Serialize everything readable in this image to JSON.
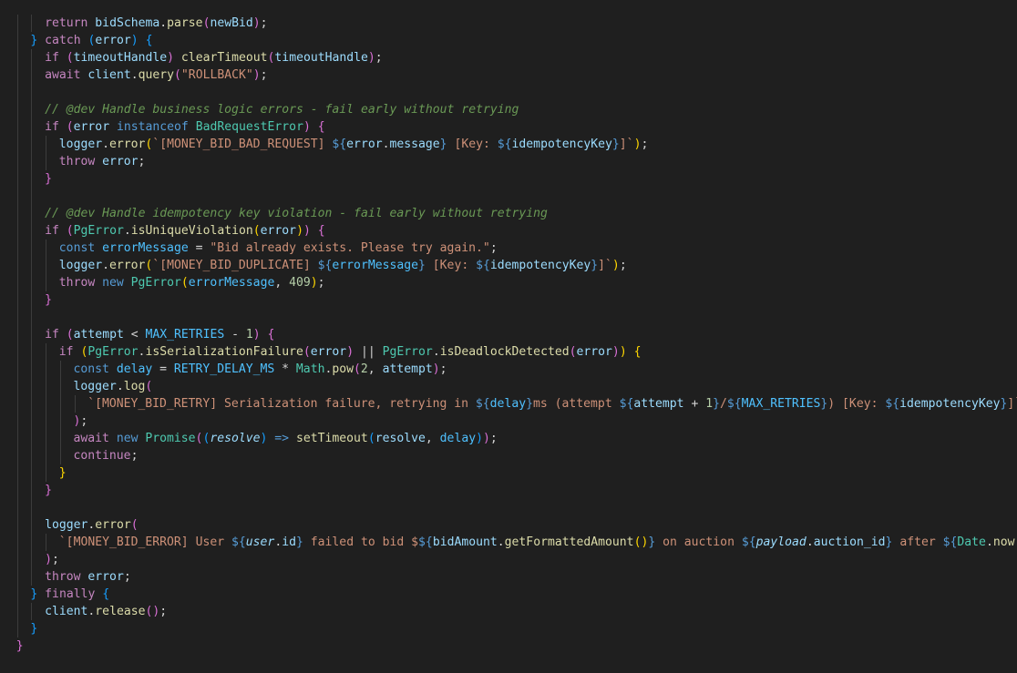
{
  "editor": {
    "theme_colors": {
      "background": "#1f1f1f",
      "keyword": "#c586c0",
      "storage": "#569cd6",
      "function": "#dcdcaa",
      "string": "#ce9178",
      "variable": "#9cdcfe",
      "class": "#4ec9b0",
      "constant": "#4fc1ff",
      "number": "#b5cea8",
      "comment": "#6a9955",
      "bracket_level_1": "#ffd700",
      "bracket_level_2": "#da70d6",
      "bracket_level_3": "#179fff"
    },
    "lines": [
      {
        "indent": 3,
        "tokens": [
          [
            "kw",
            "return"
          ],
          [
            "plain",
            " "
          ],
          [
            "var",
            "bidSchema"
          ],
          [
            "plain",
            "."
          ],
          [
            "fn",
            "parse"
          ],
          [
            "b2",
            "("
          ],
          [
            "var",
            "newBid"
          ],
          [
            "b2",
            ")"
          ],
          [
            "plain",
            ";"
          ]
        ]
      },
      {
        "indent": 2,
        "tokens": [
          [
            "b3",
            "}"
          ],
          [
            "plain",
            " "
          ],
          [
            "kw",
            "catch"
          ],
          [
            "plain",
            " "
          ],
          [
            "b3",
            "("
          ],
          [
            "var",
            "error"
          ],
          [
            "b3",
            ")"
          ],
          [
            "plain",
            " "
          ],
          [
            "b3",
            "{"
          ]
        ]
      },
      {
        "indent": 3,
        "tokens": [
          [
            "kw",
            "if"
          ],
          [
            "plain",
            " "
          ],
          [
            "b2",
            "("
          ],
          [
            "var",
            "timeoutHandle"
          ],
          [
            "b2",
            ")"
          ],
          [
            "plain",
            " "
          ],
          [
            "fn",
            "clearTimeout"
          ],
          [
            "b2",
            "("
          ],
          [
            "var",
            "timeoutHandle"
          ],
          [
            "b2",
            ")"
          ],
          [
            "plain",
            ";"
          ]
        ]
      },
      {
        "indent": 3,
        "tokens": [
          [
            "kw",
            "await"
          ],
          [
            "plain",
            " "
          ],
          [
            "var",
            "client"
          ],
          [
            "plain",
            "."
          ],
          [
            "fn",
            "query"
          ],
          [
            "b2",
            "("
          ],
          [
            "str",
            "\"ROLLBACK\""
          ],
          [
            "b2",
            ")"
          ],
          [
            "plain",
            ";"
          ]
        ]
      },
      {
        "indent": 3,
        "tokens": []
      },
      {
        "indent": 3,
        "tokens": [
          [
            "cmt",
            "// @dev Handle business logic errors - fail early without retrying"
          ]
        ]
      },
      {
        "indent": 3,
        "tokens": [
          [
            "kw",
            "if"
          ],
          [
            "plain",
            " "
          ],
          [
            "b2",
            "("
          ],
          [
            "var",
            "error"
          ],
          [
            "plain",
            " "
          ],
          [
            "kb",
            "instanceof"
          ],
          [
            "plain",
            " "
          ],
          [
            "cls",
            "BadRequestError"
          ],
          [
            "b2",
            ")"
          ],
          [
            "plain",
            " "
          ],
          [
            "b2",
            "{"
          ]
        ]
      },
      {
        "indent": 4,
        "tokens": [
          [
            "var",
            "logger"
          ],
          [
            "plain",
            "."
          ],
          [
            "fn",
            "error"
          ],
          [
            "b1",
            "("
          ],
          [
            "str",
            "`[MONEY_BID_BAD_REQUEST] "
          ],
          [
            "kb",
            "${"
          ],
          [
            "var",
            "error"
          ],
          [
            "plain",
            "."
          ],
          [
            "var",
            "message"
          ],
          [
            "kb",
            "}"
          ],
          [
            "str",
            " [Key: "
          ],
          [
            "kb",
            "${"
          ],
          [
            "var",
            "idempotencyKey"
          ],
          [
            "kb",
            "}"
          ],
          [
            "str",
            "]`"
          ],
          [
            "b1",
            ")"
          ],
          [
            "plain",
            ";"
          ]
        ]
      },
      {
        "indent": 4,
        "tokens": [
          [
            "kw",
            "throw"
          ],
          [
            "plain",
            " "
          ],
          [
            "var",
            "error"
          ],
          [
            "plain",
            ";"
          ]
        ]
      },
      {
        "indent": 3,
        "tokens": [
          [
            "b2",
            "}"
          ]
        ]
      },
      {
        "indent": 3,
        "tokens": []
      },
      {
        "indent": 3,
        "tokens": [
          [
            "cmt",
            "// @dev Handle idempotency key violation - fail early without retrying"
          ]
        ]
      },
      {
        "indent": 3,
        "tokens": [
          [
            "kw",
            "if"
          ],
          [
            "plain",
            " "
          ],
          [
            "b2",
            "("
          ],
          [
            "cls",
            "PgError"
          ],
          [
            "plain",
            "."
          ],
          [
            "fn",
            "isUniqueViolation"
          ],
          [
            "b1",
            "("
          ],
          [
            "var",
            "error"
          ],
          [
            "b1",
            ")"
          ],
          [
            "b2",
            ")"
          ],
          [
            "plain",
            " "
          ],
          [
            "b2",
            "{"
          ]
        ]
      },
      {
        "indent": 4,
        "tokens": [
          [
            "kb",
            "const"
          ],
          [
            "plain",
            " "
          ],
          [
            "const",
            "errorMessage"
          ],
          [
            "plain",
            " = "
          ],
          [
            "str",
            "\"Bid already exists. Please try again.\""
          ],
          [
            "plain",
            ";"
          ]
        ]
      },
      {
        "indent": 4,
        "tokens": [
          [
            "var",
            "logger"
          ],
          [
            "plain",
            "."
          ],
          [
            "fn",
            "error"
          ],
          [
            "b1",
            "("
          ],
          [
            "str",
            "`[MONEY_BID_DUPLICATE] "
          ],
          [
            "kb",
            "${"
          ],
          [
            "const",
            "errorMessage"
          ],
          [
            "kb",
            "}"
          ],
          [
            "str",
            " [Key: "
          ],
          [
            "kb",
            "${"
          ],
          [
            "var",
            "idempotencyKey"
          ],
          [
            "kb",
            "}"
          ],
          [
            "str",
            "]`"
          ],
          [
            "b1",
            ")"
          ],
          [
            "plain",
            ";"
          ]
        ]
      },
      {
        "indent": 4,
        "tokens": [
          [
            "kw",
            "throw"
          ],
          [
            "plain",
            " "
          ],
          [
            "kb",
            "new"
          ],
          [
            "plain",
            " "
          ],
          [
            "cls",
            "PgError"
          ],
          [
            "b1",
            "("
          ],
          [
            "const",
            "errorMessage"
          ],
          [
            "plain",
            ", "
          ],
          [
            "num",
            "409"
          ],
          [
            "b1",
            ")"
          ],
          [
            "plain",
            ";"
          ]
        ]
      },
      {
        "indent": 3,
        "tokens": [
          [
            "b2",
            "}"
          ]
        ]
      },
      {
        "indent": 3,
        "tokens": []
      },
      {
        "indent": 3,
        "tokens": [
          [
            "kw",
            "if"
          ],
          [
            "plain",
            " "
          ],
          [
            "b2",
            "("
          ],
          [
            "var",
            "attempt"
          ],
          [
            "plain",
            " < "
          ],
          [
            "const",
            "MAX_RETRIES"
          ],
          [
            "plain",
            " - "
          ],
          [
            "num",
            "1"
          ],
          [
            "b2",
            ")"
          ],
          [
            "plain",
            " "
          ],
          [
            "b2",
            "{"
          ]
        ]
      },
      {
        "indent": 4,
        "tokens": [
          [
            "kw",
            "if"
          ],
          [
            "plain",
            " "
          ],
          [
            "b1",
            "("
          ],
          [
            "cls",
            "PgError"
          ],
          [
            "plain",
            "."
          ],
          [
            "fn",
            "isSerializationFailure"
          ],
          [
            "b2",
            "("
          ],
          [
            "var",
            "error"
          ],
          [
            "b2",
            ")"
          ],
          [
            "plain",
            " || "
          ],
          [
            "cls",
            "PgError"
          ],
          [
            "plain",
            "."
          ],
          [
            "fn",
            "isDeadlockDetected"
          ],
          [
            "b2",
            "("
          ],
          [
            "var",
            "error"
          ],
          [
            "b2",
            ")"
          ],
          [
            "b1",
            ")"
          ],
          [
            "plain",
            " "
          ],
          [
            "b1",
            "{"
          ]
        ]
      },
      {
        "indent": 5,
        "tokens": [
          [
            "kb",
            "const"
          ],
          [
            "plain",
            " "
          ],
          [
            "const",
            "delay"
          ],
          [
            "plain",
            " = "
          ],
          [
            "const",
            "RETRY_DELAY_MS"
          ],
          [
            "plain",
            " * "
          ],
          [
            "cls",
            "Math"
          ],
          [
            "plain",
            "."
          ],
          [
            "fn",
            "pow"
          ],
          [
            "b2",
            "("
          ],
          [
            "num",
            "2"
          ],
          [
            "plain",
            ", "
          ],
          [
            "var",
            "attempt"
          ],
          [
            "b2",
            ")"
          ],
          [
            "plain",
            ";"
          ]
        ]
      },
      {
        "indent": 5,
        "tokens": [
          [
            "var",
            "logger"
          ],
          [
            "plain",
            "."
          ],
          [
            "fn",
            "log"
          ],
          [
            "b2",
            "("
          ]
        ]
      },
      {
        "indent": 6,
        "tokens": [
          [
            "str",
            "`[MONEY_BID_RETRY] Serialization failure, retrying in "
          ],
          [
            "kb",
            "${"
          ],
          [
            "const",
            "delay"
          ],
          [
            "kb",
            "}"
          ],
          [
            "str",
            "ms (attempt "
          ],
          [
            "kb",
            "${"
          ],
          [
            "var",
            "attempt"
          ],
          [
            "plain",
            " + "
          ],
          [
            "num",
            "1"
          ],
          [
            "kb",
            "}"
          ],
          [
            "str",
            "/"
          ],
          [
            "kb",
            "${"
          ],
          [
            "const",
            "MAX_RETRIES"
          ],
          [
            "kb",
            "}"
          ],
          [
            "str",
            ") [Key: "
          ],
          [
            "kb",
            "${"
          ],
          [
            "var",
            "idempotencyKey"
          ],
          [
            "kb",
            "}"
          ],
          [
            "str",
            "]`"
          ]
        ]
      },
      {
        "indent": 5,
        "tokens": [
          [
            "b2",
            ")"
          ],
          [
            "plain",
            ";"
          ]
        ]
      },
      {
        "indent": 5,
        "tokens": [
          [
            "kw",
            "await"
          ],
          [
            "plain",
            " "
          ],
          [
            "kb",
            "new"
          ],
          [
            "plain",
            " "
          ],
          [
            "cls",
            "Promise"
          ],
          [
            "b2",
            "("
          ],
          [
            "b3",
            "("
          ],
          [
            "it",
            "resolve"
          ],
          [
            "b3",
            ")"
          ],
          [
            "plain",
            " "
          ],
          [
            "kb",
            "=>"
          ],
          [
            "plain",
            " "
          ],
          [
            "fn",
            "setTimeout"
          ],
          [
            "b3",
            "("
          ],
          [
            "var",
            "resolve"
          ],
          [
            "plain",
            ", "
          ],
          [
            "const",
            "delay"
          ],
          [
            "b3",
            ")"
          ],
          [
            "b2",
            ")"
          ],
          [
            "plain",
            ";"
          ]
        ]
      },
      {
        "indent": 5,
        "tokens": [
          [
            "kw",
            "continue"
          ],
          [
            "plain",
            ";"
          ]
        ]
      },
      {
        "indent": 4,
        "tokens": [
          [
            "b1",
            "}"
          ]
        ]
      },
      {
        "indent": 3,
        "tokens": [
          [
            "b2",
            "}"
          ]
        ]
      },
      {
        "indent": 3,
        "tokens": []
      },
      {
        "indent": 3,
        "tokens": [
          [
            "var",
            "logger"
          ],
          [
            "plain",
            "."
          ],
          [
            "fn",
            "error"
          ],
          [
            "b2",
            "("
          ]
        ]
      },
      {
        "indent": 4,
        "tokens": [
          [
            "str",
            "`[MONEY_BID_ERROR] User "
          ],
          [
            "kb",
            "${"
          ],
          [
            "it",
            "user"
          ],
          [
            "plain",
            "."
          ],
          [
            "var",
            "id"
          ],
          [
            "kb",
            "}"
          ],
          [
            "str",
            " failed to bid $"
          ],
          [
            "kb",
            "${"
          ],
          [
            "var",
            "bidAmount"
          ],
          [
            "plain",
            "."
          ],
          [
            "fn",
            "getFormattedAmount"
          ],
          [
            "b1",
            "()"
          ],
          [
            "kb",
            "}"
          ],
          [
            "str",
            " on auction "
          ],
          [
            "kb",
            "${"
          ],
          [
            "it",
            "payload"
          ],
          [
            "plain",
            "."
          ],
          [
            "var",
            "auction_id"
          ],
          [
            "kb",
            "}"
          ],
          [
            "str",
            " after "
          ],
          [
            "kb",
            "${"
          ],
          [
            "cls",
            "Date"
          ],
          [
            "plain",
            "."
          ],
          [
            "fn",
            "now"
          ],
          [
            "b1",
            "()"
          ],
          [
            "plain",
            " -"
          ]
        ]
      },
      {
        "indent": 3,
        "tokens": [
          [
            "b2",
            ")"
          ],
          [
            "plain",
            ";"
          ]
        ]
      },
      {
        "indent": 3,
        "tokens": [
          [
            "kw",
            "throw"
          ],
          [
            "plain",
            " "
          ],
          [
            "var",
            "error"
          ],
          [
            "plain",
            ";"
          ]
        ]
      },
      {
        "indent": 2,
        "tokens": [
          [
            "b3",
            "}"
          ],
          [
            "plain",
            " "
          ],
          [
            "kw",
            "finally"
          ],
          [
            "plain",
            " "
          ],
          [
            "b3",
            "{"
          ]
        ]
      },
      {
        "indent": 3,
        "tokens": [
          [
            "var",
            "client"
          ],
          [
            "plain",
            "."
          ],
          [
            "fn",
            "release"
          ],
          [
            "b2",
            "()"
          ],
          [
            "plain",
            ";"
          ]
        ]
      },
      {
        "indent": 2,
        "tokens": [
          [
            "b3",
            "}"
          ]
        ]
      },
      {
        "indent": 1,
        "tokens": [
          [
            "b2",
            "}"
          ]
        ]
      }
    ]
  }
}
